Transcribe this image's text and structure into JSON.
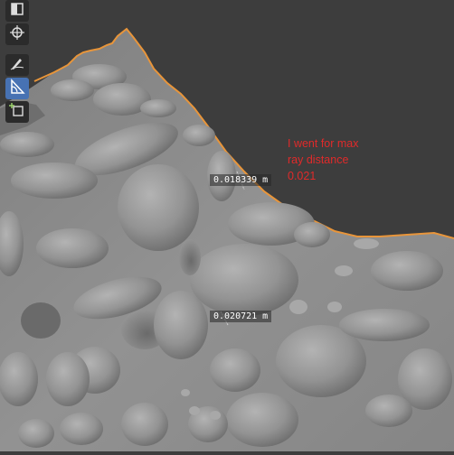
{
  "toolbar": {
    "tools": [
      {
        "icon": "select-box-icon",
        "active": false
      },
      {
        "icon": "cursor-icon",
        "active": false
      },
      {
        "icon": "annotate-icon",
        "active": false
      },
      {
        "icon": "measure-icon",
        "active": true
      },
      {
        "icon": "add-cube-icon",
        "active": false
      }
    ]
  },
  "measurements": {
    "upper": "0.018339 m",
    "lower": "0.020721 m"
  },
  "annotation": {
    "line1": "I went for max",
    "line2": "ray distance",
    "line3": "0.021",
    "color": "#e02a2a"
  },
  "colors": {
    "background": "#3d3d3d",
    "mesh": "#8e8e8e",
    "outline": "#e8953a",
    "active_tool": "#4772b3"
  }
}
